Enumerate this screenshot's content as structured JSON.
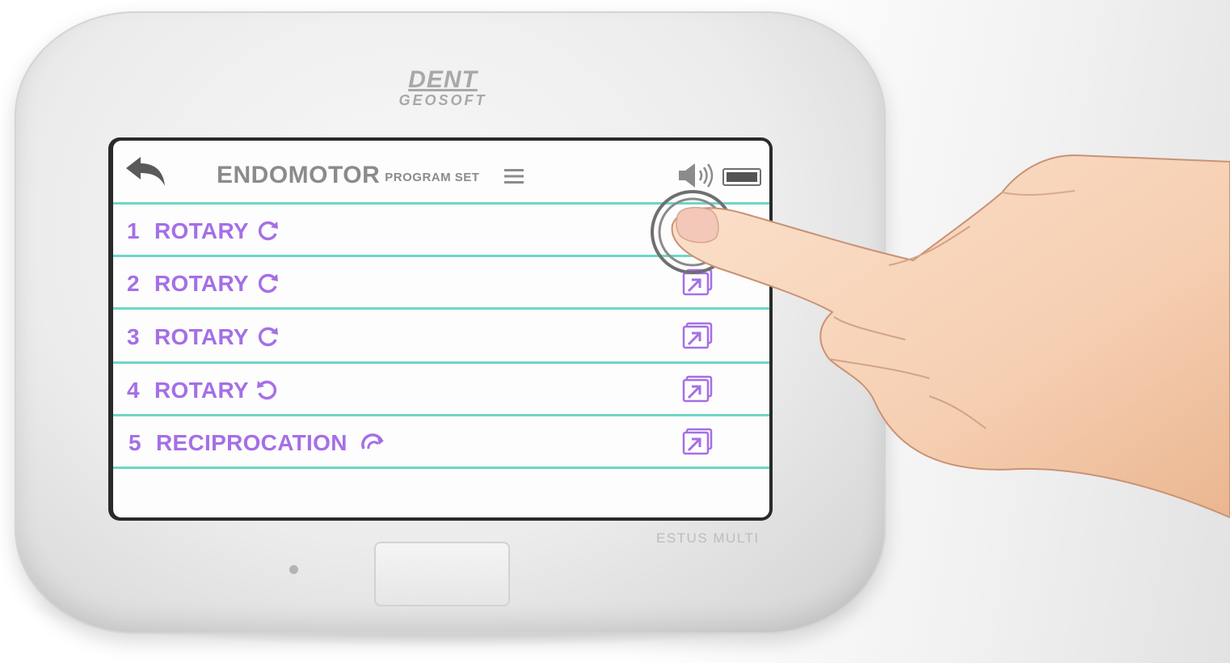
{
  "brand": {
    "top": "DENT",
    "bottom": "GEOSOFT"
  },
  "model_label": "ESTUS MULTI",
  "header": {
    "title": "ENDOMOTOR",
    "subtitle": "PROGRAM SET",
    "back_icon": "back-arrow-icon",
    "menu_icon": "hamburger-menu-icon"
  },
  "status": {
    "volume_icon": "speaker-icon",
    "battery_icon": "battery-icon"
  },
  "programs": [
    {
      "num": "1",
      "label": "ROTARY",
      "direction_icon": "rotate-clockwise-icon",
      "action_icon": "select-program-icon"
    },
    {
      "num": "2",
      "label": "ROTARY",
      "direction_icon": "rotate-clockwise-icon",
      "action_icon": "select-program-icon"
    },
    {
      "num": "3",
      "label": "ROTARY",
      "direction_icon": "rotate-clockwise-icon",
      "action_icon": "select-program-icon"
    },
    {
      "num": "4",
      "label": "ROTARY",
      "direction_icon": "rotate-counterclockwise-icon",
      "action_icon": "select-program-icon"
    },
    {
      "num": "5",
      "label": "RECIPROCATION",
      "direction_icon": "reciprocation-icon",
      "action_icon": "select-program-icon"
    }
  ],
  "colors": {
    "accent": "#a56fe6",
    "divider": "#6fd6c6",
    "header_text": "#8b8b8b"
  }
}
